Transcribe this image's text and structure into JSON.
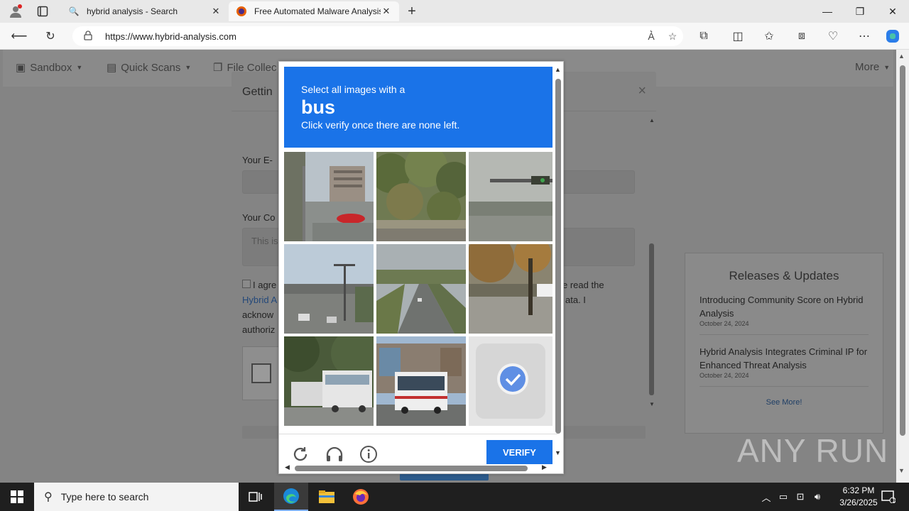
{
  "browser": {
    "tabs": [
      {
        "label": "hybrid analysis - Search",
        "icon": "search-icon",
        "active": false
      },
      {
        "label": "Free Automated Malware Analysis",
        "icon": "firefox-favicon-icon",
        "active": true
      }
    ],
    "url": "https://www.hybrid-analysis.com"
  },
  "site_nav": {
    "sandbox": "Sandbox",
    "quick_scans": "Quick Scans",
    "file_collections": "File Collec",
    "more": "More"
  },
  "modal": {
    "title": "Gettin",
    "email_label": "Your E-",
    "comment_label": "Your Co",
    "comment_placeholder": "This is",
    "agree_left_1": "I agre",
    "agree_left_2": "Hybrid A",
    "agree_left_3": "acknow",
    "agree_left_4": "authoriz",
    "agree_right_1": "e read the",
    "agree_right_2": "ata. I"
  },
  "captcha": {
    "instruction_line1": "Select all images with a",
    "target_word": "bus",
    "instruction_line3": "Click verify once there are none left.",
    "verify_label": "VERIFY",
    "tiles": [
      {
        "subject": "street-with-red-car",
        "selected": false
      },
      {
        "subject": "trees-roadside",
        "selected": false
      },
      {
        "subject": "traffic-light-road",
        "selected": false
      },
      {
        "subject": "highway-overpass",
        "selected": false
      },
      {
        "subject": "divided-highway",
        "selected": false
      },
      {
        "subject": "street-with-tree",
        "selected": false
      },
      {
        "subject": "bus-in-trees",
        "selected": false
      },
      {
        "subject": "city-bus",
        "selected": false
      },
      {
        "subject": "selected-empty",
        "selected": true
      }
    ]
  },
  "releases": {
    "title": "Releases & Updates",
    "items": [
      {
        "title": "Introducing Community Score on Hybrid Analysis",
        "date": "October 24, 2024"
      },
      {
        "title": "Hybrid Analysis Integrates Criminal IP for Enhanced Threat Analysis",
        "date": "October 24, 2024"
      }
    ],
    "see_more": "See More!"
  },
  "taskbar": {
    "search_placeholder": "Type here to search",
    "time": "6:32 PM",
    "date": "3/26/2025",
    "notification_count": "1"
  },
  "watermark": "ANY RUN"
}
